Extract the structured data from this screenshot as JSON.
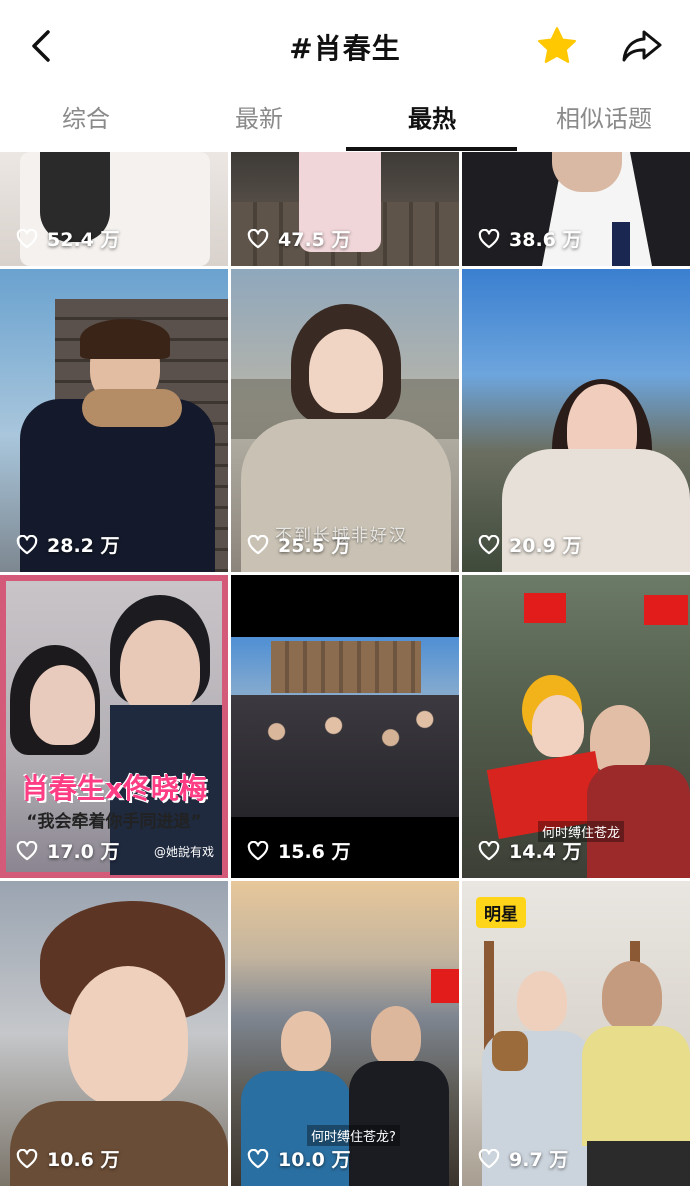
{
  "header": {
    "title": "#肖春生"
  },
  "tabs": [
    {
      "label": "综合",
      "active": false
    },
    {
      "label": "最新",
      "active": false
    },
    {
      "label": "最热",
      "active": true
    },
    {
      "label": "相似话题",
      "active": false
    }
  ],
  "colors": {
    "accent_star": "#ffc800",
    "badge": "#ffd51a",
    "poster_pink": "#ff3d84"
  },
  "videos": [
    {
      "likes": "52.4 万"
    },
    {
      "likes": "47.5 万"
    },
    {
      "likes": "38.6 万"
    },
    {
      "likes": "28.2 万"
    },
    {
      "likes": "25.5 万",
      "overlay": "不到长城非好汉"
    },
    {
      "likes": "20.9 万"
    },
    {
      "likes": "17.0 万",
      "poster_title": "肖春生x佟晓梅",
      "poster_sub": "“我会牵着你手同进退”",
      "credit": "@她說有戏"
    },
    {
      "likes": "15.6 万"
    },
    {
      "likes": "14.4 万",
      "caption": "何时缚住苍龙"
    },
    {
      "likes": "10.6 万"
    },
    {
      "likes": "10.0 万",
      "caption": "何时缚住苍龙?"
    },
    {
      "likes": "9.7 万",
      "badge": "明星"
    }
  ]
}
